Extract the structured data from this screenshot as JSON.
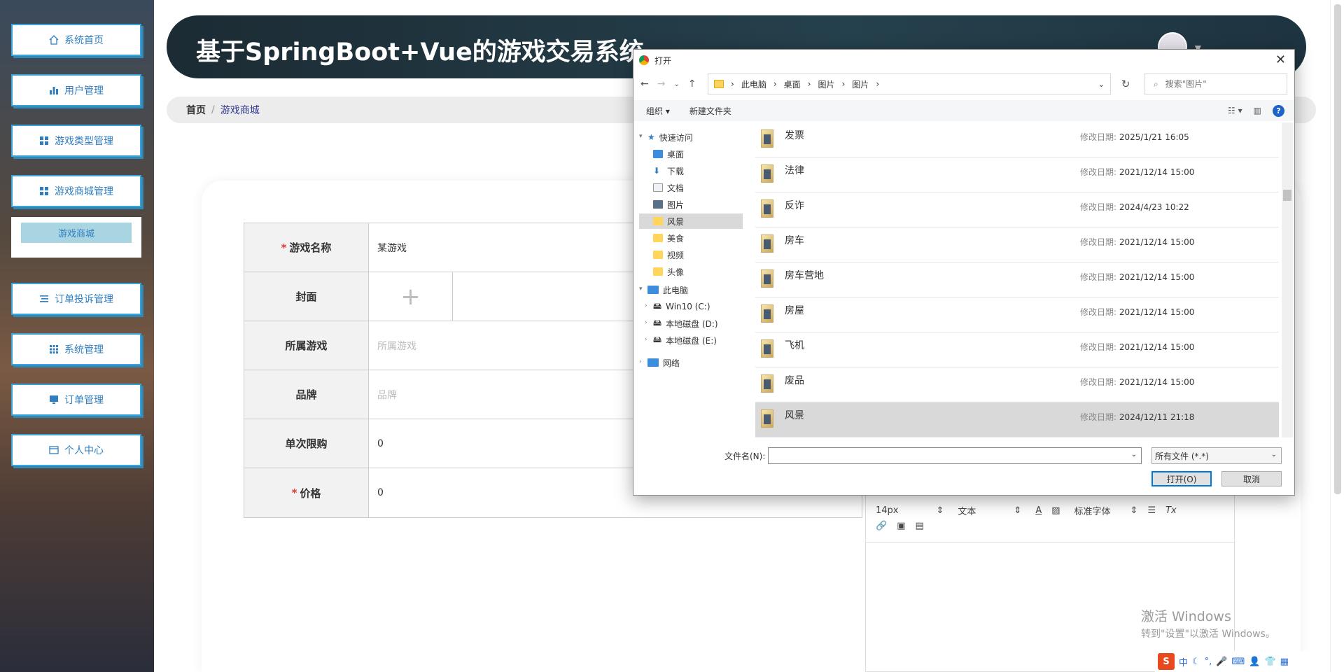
{
  "sidebar": {
    "items": [
      {
        "label": "系统首页",
        "icon": "home-icon"
      },
      {
        "label": "用户管理",
        "icon": "bar-chart-icon"
      },
      {
        "label": "游戏类型管理",
        "icon": "grid-icon"
      },
      {
        "label": "游戏商城管理",
        "icon": "grid-icon"
      },
      {
        "label": "订单投诉管理",
        "icon": "list-icon"
      },
      {
        "label": "系统管理",
        "icon": "apps-icon"
      },
      {
        "label": "订单管理",
        "icon": "monitor-icon"
      },
      {
        "label": "个人中心",
        "icon": "card-icon"
      }
    ],
    "submenu": {
      "label": "游戏商城"
    }
  },
  "header": {
    "title": "基于SpringBoot+Vue的游戏交易系统"
  },
  "breadcrumb": {
    "home": "首页",
    "separator": "/",
    "current": "游戏商城"
  },
  "form": {
    "rows": [
      {
        "label": "游戏名称",
        "required": "*",
        "value": "某游戏"
      },
      {
        "label": "封面",
        "upload_symbol": "+"
      },
      {
        "label": "所属游戏",
        "placeholder": "所属游戏"
      },
      {
        "label": "品牌",
        "placeholder": "品牌"
      },
      {
        "label": "单次限购",
        "value": "0"
      },
      {
        "label": "价格",
        "required": "*",
        "value": "0"
      }
    ]
  },
  "editor": {
    "font_size": "14px",
    "block_type": "文本",
    "font_family": "标准字体"
  },
  "watermark": {
    "line1": "激活 Windows",
    "line2": "转到\"设置\"以激活 Windows。"
  },
  "tray": {
    "ime": "中"
  },
  "dialog": {
    "title": "打开",
    "path": [
      "此电脑",
      "桌面",
      "图片",
      "图片"
    ],
    "search_placeholder": "搜索\"图片\"",
    "toolbar": {
      "organize": "组织 ▾",
      "new_folder": "新建文件夹"
    },
    "tree": {
      "quick_access": "快速访问",
      "quick_items": [
        {
          "label": "桌面",
          "pinned": "📌"
        },
        {
          "label": "下载",
          "pinned": "📌"
        },
        {
          "label": "文档",
          "pinned": "📌"
        },
        {
          "label": "图片",
          "pinned": "📌"
        },
        {
          "label": "风景"
        },
        {
          "label": "美食"
        },
        {
          "label": "视频"
        },
        {
          "label": "头像"
        }
      ],
      "this_pc": "此电脑",
      "drives": [
        "Win10 (C:)",
        "本地磁盘 (D:)",
        "本地磁盘 (E:)"
      ],
      "network": "网络"
    },
    "date_label": "修改日期:",
    "files": [
      {
        "name": "发票",
        "date": "2025/1/21 16:05"
      },
      {
        "name": "法律",
        "date": "2021/12/14 15:00"
      },
      {
        "name": "反诈",
        "date": "2024/4/23 10:22"
      },
      {
        "name": "房车",
        "date": "2021/12/14 15:00"
      },
      {
        "name": "房车营地",
        "date": "2021/12/14 15:00"
      },
      {
        "name": "房屋",
        "date": "2021/12/14 15:00"
      },
      {
        "name": "飞机",
        "date": "2021/12/14 15:00"
      },
      {
        "name": "废品",
        "date": "2021/12/14 15:00"
      },
      {
        "name": "风景",
        "date": "2024/12/11 21:18"
      }
    ],
    "filename_label": "文件名(N):",
    "filename_value": "",
    "filter": "所有文件 (*.*)",
    "open_button": "打开(O)",
    "cancel_button": "取消"
  }
}
